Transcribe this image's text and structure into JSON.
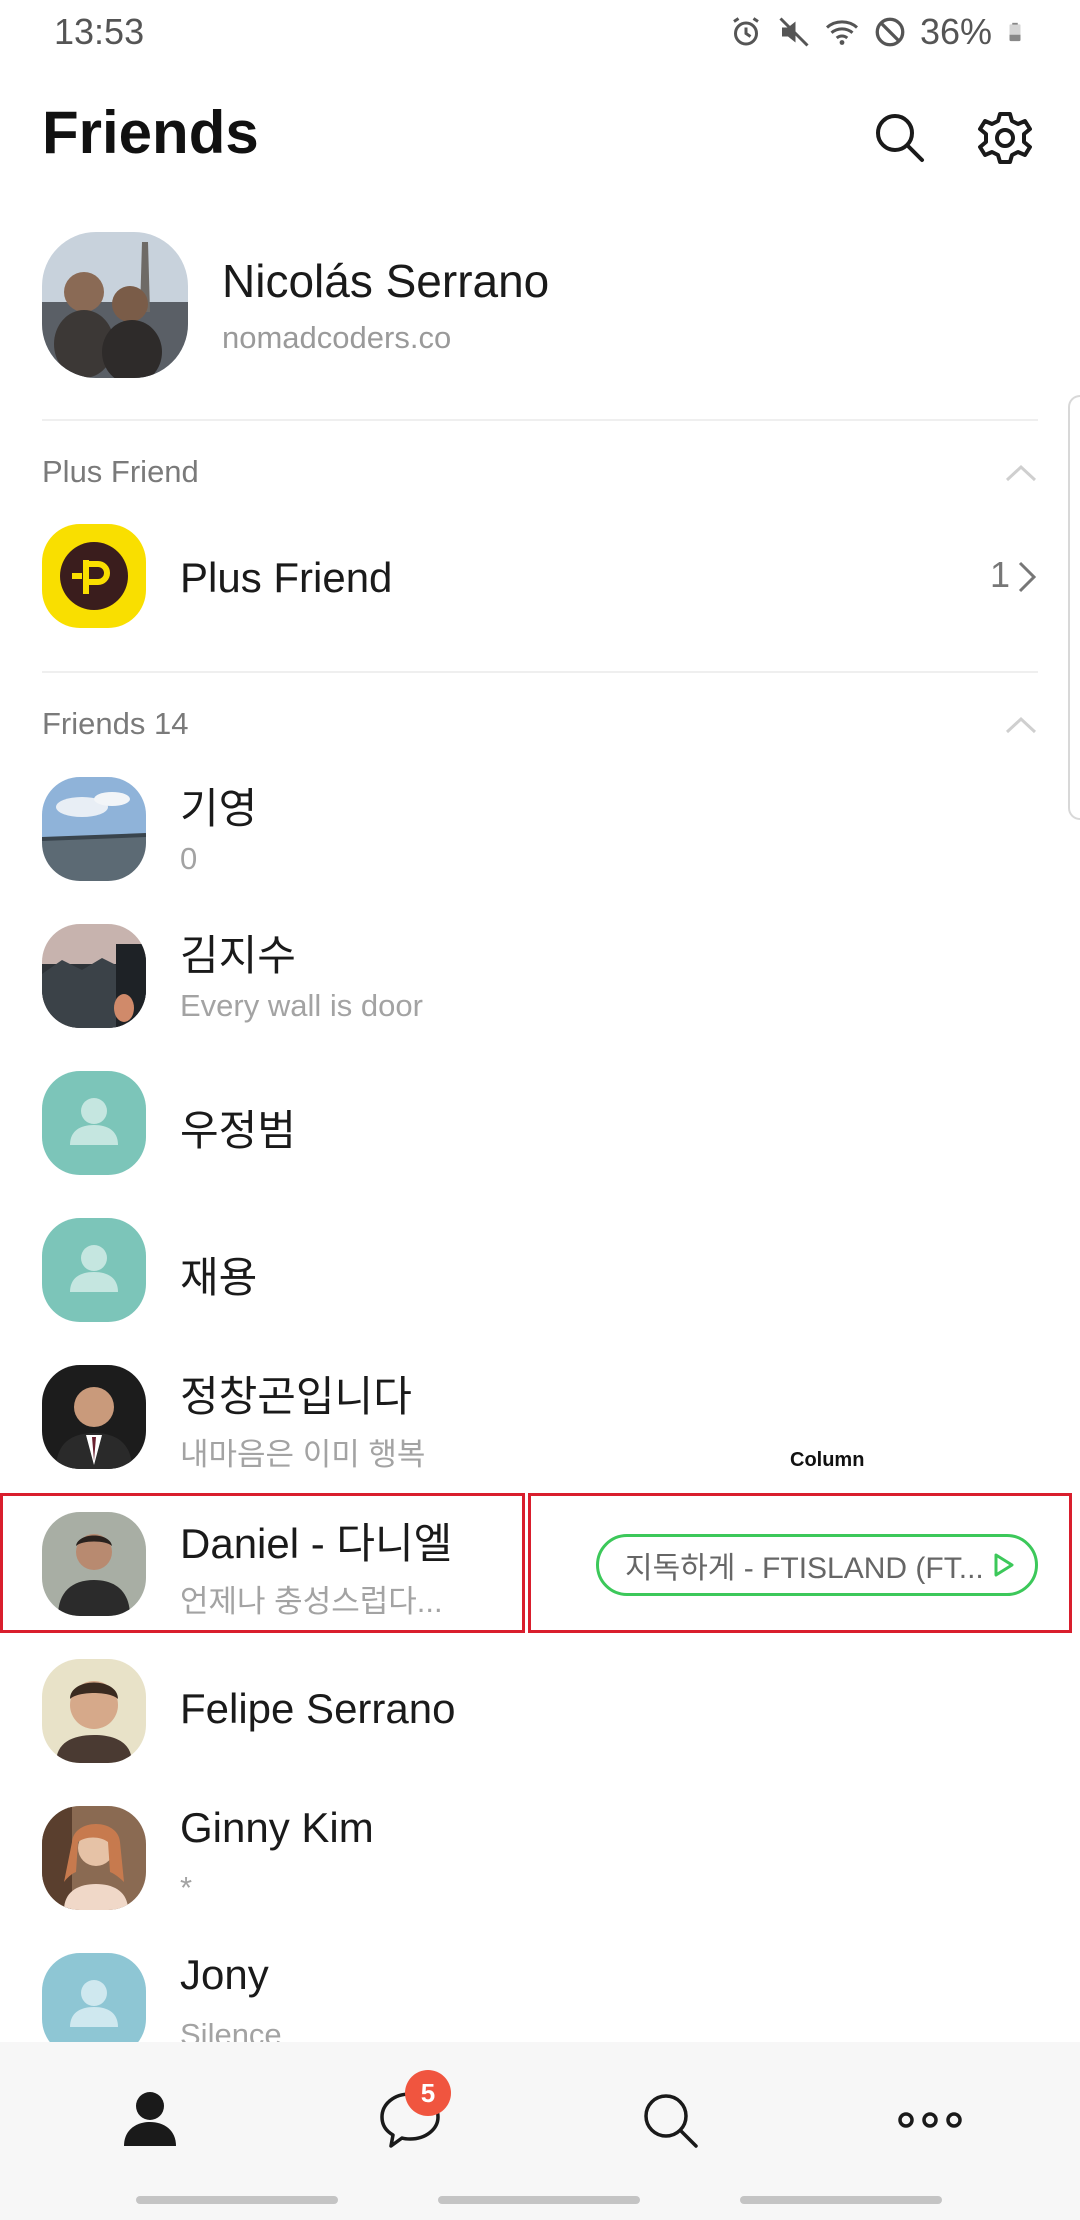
{
  "status_bar": {
    "time": "13:53",
    "battery": "36%"
  },
  "header": {
    "title": "Friends"
  },
  "profile": {
    "name": "Nicolás Serrano",
    "status": "nomadcoders.co"
  },
  "plus_section": {
    "label": "Plus Friend",
    "item_name": "Plus Friend",
    "count": "1"
  },
  "friends_section": {
    "label": "Friends 14"
  },
  "friends": [
    {
      "name": "기영",
      "status": "0"
    },
    {
      "name": "김지수",
      "status": "Every wall is door"
    },
    {
      "name": "우정범",
      "status": ""
    },
    {
      "name": "재용",
      "status": ""
    },
    {
      "name": "정창곤입니다",
      "status": "내마음은 이미 행복"
    },
    {
      "name": "Daniel - 다니엘",
      "status": "언제나 충성스럽다..."
    },
    {
      "name": "Felipe Serrano",
      "status": ""
    },
    {
      "name": "Ginny Kim",
      "status": "*"
    },
    {
      "name": "Jony",
      "status": "Silence"
    }
  ],
  "music": {
    "label": "지독하게 - FTISLAND (FT..."
  },
  "annotation": {
    "label": "Column"
  },
  "tabbar": {
    "chat_badge": "5"
  },
  "colors": {
    "accent_green": "#3cc85a",
    "badge_red": "#f0553f",
    "plus_yellow": "#f9df00",
    "default_avatar": "#7cc5b9",
    "annotation_red": "#d91e2d"
  }
}
